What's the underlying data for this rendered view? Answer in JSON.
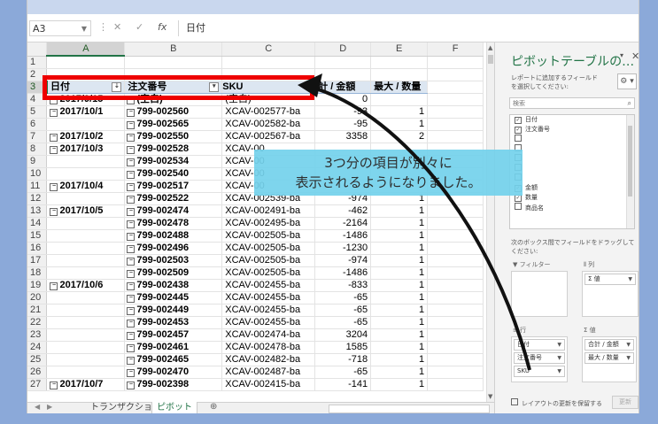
{
  "formula_bar": {
    "name_box": "A3",
    "cancel_glyph": "✕",
    "enter_glyph": "✓",
    "fx_glyph": "fx",
    "formula_value": "日付"
  },
  "columns": [
    "A",
    "B",
    "C",
    "D",
    "E",
    "F"
  ],
  "rows": [
    {
      "n": "1",
      "cells": [
        "",
        "",
        "",
        "",
        ""
      ]
    },
    {
      "n": "2",
      "cells": [
        "",
        "",
        "",
        "",
        ""
      ]
    },
    {
      "n": "3",
      "header": true,
      "cells": [
        "日付",
        "注文番号",
        "SKU",
        "計 / 金額",
        "最大 / 数量"
      ]
    },
    {
      "n": "4",
      "cells": [
        "2017/9/15",
        "(空白)",
        "(空白)",
        "0",
        ""
      ]
    },
    {
      "n": "5",
      "cells": [
        "2017/10/1",
        "799-002560",
        "XCAV-002577-ba",
        "-93",
        "1"
      ]
    },
    {
      "n": "6",
      "cells": [
        "",
        "799-002565",
        "XCAV-002582-ba",
        "-95",
        "1"
      ]
    },
    {
      "n": "7",
      "cells": [
        "2017/10/2",
        "799-002550",
        "XCAV-002567-ba",
        "3358",
        "2"
      ]
    },
    {
      "n": "8",
      "cells": [
        "2017/10/3",
        "799-002528",
        "XCAV-00",
        "",
        ""
      ]
    },
    {
      "n": "9",
      "cells": [
        "",
        "799-002534",
        "XCAV-00",
        "",
        ""
      ]
    },
    {
      "n": "10",
      "cells": [
        "",
        "799-002540",
        "XCAV-00",
        "",
        ""
      ]
    },
    {
      "n": "11",
      "cells": [
        "2017/10/4",
        "799-002517",
        "XCAV-00",
        "",
        ""
      ]
    },
    {
      "n": "12",
      "cells": [
        "",
        "799-002522",
        "XCAV-002539-ba",
        "-974",
        "1"
      ]
    },
    {
      "n": "13",
      "cells": [
        "2017/10/5",
        "799-002474",
        "XCAV-002491-ba",
        "-462",
        "1"
      ]
    },
    {
      "n": "14",
      "cells": [
        "",
        "799-002478",
        "XCAV-002495-ba",
        "-2164",
        "1"
      ]
    },
    {
      "n": "15",
      "cells": [
        "",
        "799-002488",
        "XCAV-002505-ba",
        "-1486",
        "1"
      ]
    },
    {
      "n": "16",
      "cells": [
        "",
        "799-002496",
        "XCAV-002505-ba",
        "-1230",
        "1"
      ]
    },
    {
      "n": "17",
      "cells": [
        "",
        "799-002503",
        "XCAV-002505-ba",
        "-974",
        "1"
      ]
    },
    {
      "n": "18",
      "cells": [
        "",
        "799-002509",
        "XCAV-002505-ba",
        "-1486",
        "1"
      ]
    },
    {
      "n": "19",
      "cells": [
        "2017/10/6",
        "799-002438",
        "XCAV-002455-ba",
        "-833",
        "1"
      ]
    },
    {
      "n": "20",
      "cells": [
        "",
        "799-002445",
        "XCAV-002455-ba",
        "-65",
        "1"
      ]
    },
    {
      "n": "21",
      "cells": [
        "",
        "799-002449",
        "XCAV-002455-ba",
        "-65",
        "1"
      ]
    },
    {
      "n": "22",
      "cells": [
        "",
        "799-002453",
        "XCAV-002455-ba",
        "-65",
        "1"
      ]
    },
    {
      "n": "23",
      "cells": [
        "",
        "799-002457",
        "XCAV-002474-ba",
        "3204",
        "1"
      ]
    },
    {
      "n": "24",
      "cells": [
        "",
        "799-002461",
        "XCAV-002478-ba",
        "1585",
        "1"
      ]
    },
    {
      "n": "25",
      "cells": [
        "",
        "799-002465",
        "XCAV-002482-ba",
        "-718",
        "1"
      ]
    },
    {
      "n": "26",
      "cells": [
        "",
        "799-002470",
        "XCAV-002487-ba",
        "-65",
        "1"
      ]
    },
    {
      "n": "27",
      "cells": [
        "2017/10/7",
        "799-002398",
        "XCAV-002415-ba",
        "-141",
        "1"
      ]
    }
  ],
  "sheet_tabs": [
    "トランザクション",
    "ピボット"
  ],
  "add_sheet": "⊕",
  "pivot_pane": {
    "title": "ピボットテーブルの…",
    "dropdown": "▾",
    "close": "✕",
    "instruction": "レポートに追加するフィールドを選択してください:",
    "gear": "⚙ ▾",
    "search_placeholder": "検索",
    "fields": [
      {
        "label": "日付",
        "checked": true
      },
      {
        "label": "注文番号",
        "checked": true
      },
      {
        "label": "",
        "checked": false
      },
      {
        "label": "",
        "checked": false
      },
      {
        "label": "",
        "checked": false
      },
      {
        "label": "",
        "checked": false
      },
      {
        "label": "",
        "checked": false
      },
      {
        "label": "金額",
        "checked": true
      },
      {
        "label": "数量",
        "checked": true
      },
      {
        "label": "商品名",
        "checked": false
      }
    ],
    "drag_instruction": "次のボックス間でフィールドをドラッグしてください:",
    "filter_label": "フィルター",
    "columns_label": "列",
    "rows_label": "行",
    "values_label": "値",
    "column_chips": [
      "Σ 値"
    ],
    "row_chips": [
      "日付",
      "注文番号",
      "SKU"
    ],
    "value_chips": [
      "合計 / 金額",
      "最大 / 数量"
    ],
    "defer_label": "レイアウトの更新を保留する",
    "update_button": "更新"
  },
  "callout": {
    "line1": "3つ分の項目が別々に",
    "line2": "表示されるようになりました。"
  },
  "colors": {
    "accent": "#217346",
    "callout": "#74d2ec",
    "highlight": "#e00000",
    "background": "#8ba9d9"
  }
}
